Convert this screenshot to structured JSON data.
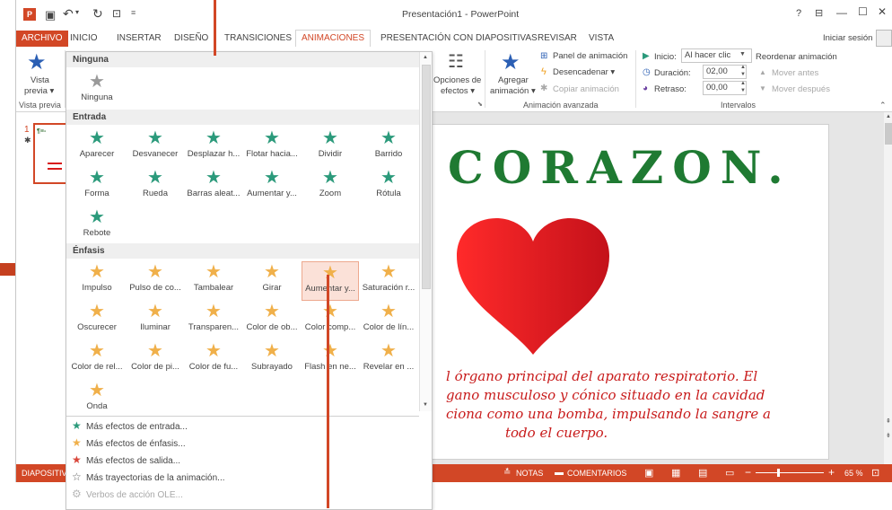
{
  "app": {
    "title": "Presentación1 - PowerPoint",
    "signin": "Iniciar sesión",
    "help": "?"
  },
  "tabs": [
    {
      "label": "ARCHIVO"
    },
    {
      "label": "INICIO"
    },
    {
      "label": "INSERTAR"
    },
    {
      "label": "DISEÑO"
    },
    {
      "label": "TRANSICIONES"
    },
    {
      "label": "ANIMACIONES"
    },
    {
      "label": "PRESENTACIÓN CON DIAPOSITIVAS"
    },
    {
      "label": "REVISAR"
    },
    {
      "label": "VISTA"
    }
  ],
  "ribbon": {
    "preview_label": "Vista previa",
    "preview_label_a": "Vista",
    "preview_label_b": "previa ▾",
    "preview_group": "Vista previa",
    "options_a": "Opciones de",
    "options_b": "efectos ▾",
    "add_a": "Agregar",
    "add_b": "animación ▾",
    "panel": "Panel de animación",
    "trigger": "Desencadenar ▾",
    "copy": "Copiar animación",
    "advanced_group": "Animación avanzada",
    "start_label": "Inicio:",
    "start_value": "Al hacer clic",
    "duration_label": "Duración:",
    "duration_value": "02,00",
    "delay_label": "Retraso:",
    "delay_value": "00,00",
    "reorder": "Reordenar animación",
    "move_earlier": "Mover antes",
    "move_later": "Mover después",
    "timing_group": "Intervalos"
  },
  "gallery": {
    "none_header": "Ninguna",
    "none_item": "Ninguna",
    "entrance_header": "Entrada",
    "entrance": [
      "Aparecer",
      "Desvanecer",
      "Desplazar h...",
      "Flotar hacia...",
      "Dividir",
      "Barrido",
      "Forma",
      "Rueda",
      "Barras aleat...",
      "Aumentar y...",
      "Zoom",
      "Rótula",
      "Rebote"
    ],
    "emphasis_header": "Énfasis",
    "emphasis": [
      "Impulso",
      "Pulso de co...",
      "Tambalear",
      "Girar",
      "Aumentar y...",
      "Saturación r...",
      "Oscurecer",
      "Iluminar",
      "Transparen...",
      "Color de ob...",
      "Color comp...",
      "Color de lín...",
      "Color de rel...",
      "Color de pi...",
      "Color de fu...",
      "Subrayado",
      "Flash en ne...",
      "Revelar en ...",
      "Onda"
    ],
    "more": [
      "Más efectos de entrada...",
      "Más efectos de énfasis...",
      "Más efectos de salida...",
      "Más trayectorias de la animación...",
      "Verbos de acción OLE..."
    ],
    "colors": {
      "entrance": "#2b9a7b",
      "emphasis": "#f0b04a",
      "exit": "#d9463a",
      "none": "#9a9a9a"
    }
  },
  "slide": {
    "number": "1",
    "title_text": "CORAZON.",
    "body": [
      "l órgano principal del aparato respiratorio. El",
      "gano musculoso y cónico situado en la cavidad",
      "ciona como una bomba, impulsando la sangre a",
      "todo el cuerpo."
    ],
    "heart_color": "#d81a1a"
  },
  "status": {
    "slide_label": "DIAPOSITIVA",
    "notes": "NOTAS",
    "comments": "COMENTARIOS",
    "zoom": "65 %"
  }
}
